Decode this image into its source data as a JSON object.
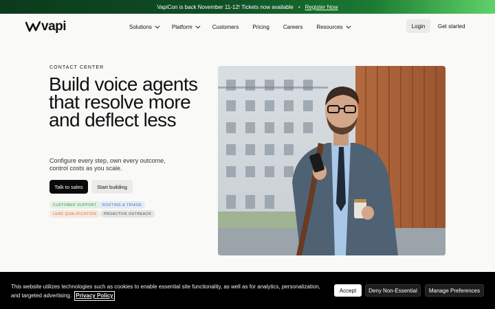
{
  "announcement": {
    "text": "VapiCon is back November 11-12! Tickets now available",
    "separator": "•",
    "link_label": "Register Now"
  },
  "header": {
    "logo_text": "vapi",
    "menu": [
      {
        "label": "Solutions",
        "has_dropdown": true
      },
      {
        "label": "Platform",
        "has_dropdown": true
      },
      {
        "label": "Customers",
        "has_dropdown": false
      },
      {
        "label": "Pricing",
        "has_dropdown": false
      },
      {
        "label": "Careers",
        "has_dropdown": false
      },
      {
        "label": "Resources",
        "has_dropdown": true
      }
    ],
    "login_label": "Login",
    "get_started_label": "Get started"
  },
  "hero": {
    "eyebrow": "CONTACT CENTER",
    "headline": "Build voice agents that resolve more and deflect less",
    "subtext": "Configure every step, own every outcome, control costs as you scale.",
    "primary_cta": "Talk to sales",
    "secondary_cta": "Start building",
    "tags": [
      "CUSTOMER SUPPORT",
      "ROUTING & TRIAGE",
      "LEAD QUALIFICATION",
      "PROACTIVE OUTREACH"
    ]
  },
  "cookie_banner": {
    "text": "This website utilizes technologies such as cookies to enable essential site functionality, as well as for analytics, personalization, and targeted advertising.",
    "policy_link": "Privacy Policy",
    "accept_label": "Accept",
    "deny_label": "Deny Non-Essential",
    "manage_label": "Manage Preferences"
  },
  "colors": {
    "announcement_bg": "#0f4f24",
    "page_bg": "#f9f9f7",
    "primary_button": "#0a0a0a",
    "tag_green": "#2f8a45",
    "tag_blue": "#3d62b0",
    "tag_orange": "#c0703f"
  }
}
